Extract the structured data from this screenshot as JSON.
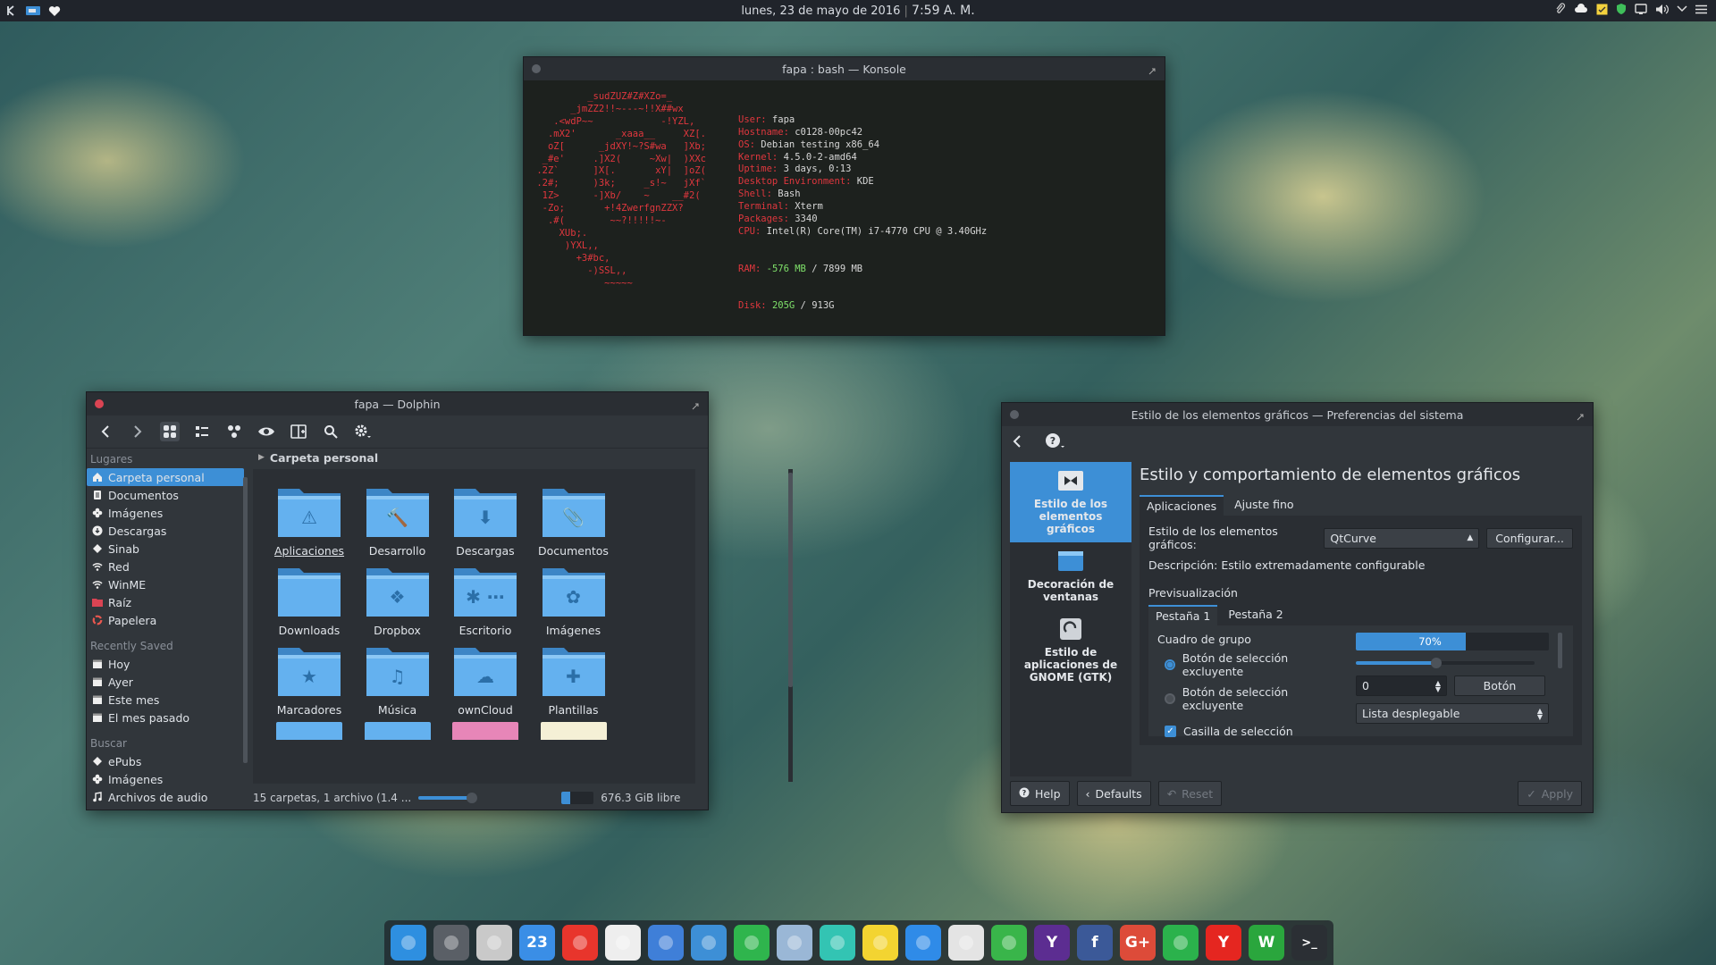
{
  "top_panel": {
    "clock_date": "lunes, 23 de mayo de 2016",
    "clock_time": "7:59 A. M.",
    "left_icons": [
      "kde-launcher-icon",
      "pager-icon",
      "heart-icon"
    ],
    "tray_icons": [
      "paperclip-icon",
      "cloud-icon",
      "note-icon",
      "shield-icon",
      "display-icon",
      "volume-icon",
      "chevron-down-icon",
      "menu-icon"
    ]
  },
  "konsole": {
    "title": "fapa : bash — Konsole",
    "logo_lines": [
      "          _sudZUZ#Z#XZo=_",
      "       _jmZZ2!!~---~!!X##wx",
      "    .<wdP~~            -!YZL,",
      "   .mX2'       _xaaa__     XZ[.",
      "   oZ[      _jdXY!~?S#wa   ]Xb;",
      "  _#e'     .]X2(     ~Xw|  )XXc",
      " .2Z`      ]X[.       xY|  ]oZ(",
      " .2#;      )3k;     _s!~   jXf`",
      "  1Z>      -]Xb/    ~    __#2(",
      "  -Zo;       +!4ZwerfgnZZX?",
      "   .#(        ~~?!!!!!~-",
      "     XUb;.",
      "      )YXL,,",
      "        +3#bc,",
      "          -)SSL,,",
      "             ~~~~~"
    ],
    "info": [
      {
        "key": "User:",
        "value": " fapa"
      },
      {
        "key": "Hostname:",
        "value": " c0128-00pc42"
      },
      {
        "key": "OS:",
        "value": " Debian testing x86_64"
      },
      {
        "key": "Kernel:",
        "value": " 4.5.0-2-amd64"
      },
      {
        "key": "Uptime:",
        "value": " 3 days, 0:13"
      },
      {
        "key": "Desktop Environment:",
        "value": " KDE"
      },
      {
        "key": "Shell:",
        "value": " Bash"
      },
      {
        "key": "Terminal:",
        "value": " Xterm"
      },
      {
        "key": "Packages:",
        "value": " 3340"
      },
      {
        "key": "CPU:",
        "value": " Intel(R) Core(TM) i7-4770 CPU @ 3.40GHz"
      }
    ],
    "ram_key": "RAM:",
    "ram_used": "-576 MB",
    "ram_total": " / 7899 MB",
    "disk_key": "Disk:",
    "disk_used": "205G",
    "disk_total": " / 913G"
  },
  "dolphin": {
    "title": "fapa — Dolphin",
    "places_header": "Lugares",
    "places": [
      {
        "label": "Carpeta personal",
        "icon": "home-icon",
        "selected": true
      },
      {
        "label": "Documentos",
        "icon": "document-icon"
      },
      {
        "label": "Imágenes",
        "icon": "flower-icon"
      },
      {
        "label": "Descargas",
        "icon": "download-icon"
      },
      {
        "label": "Sinab",
        "icon": "diamond-icon"
      },
      {
        "label": "Red",
        "icon": "wifi-icon"
      },
      {
        "label": "WinME",
        "icon": "wifi-icon"
      },
      {
        "label": "Raíz",
        "icon": "folder-red-icon"
      },
      {
        "label": "Papelera",
        "icon": "recycle-icon"
      }
    ],
    "recent_header": "Recently Saved",
    "recent": [
      {
        "label": "Hoy",
        "icon": "calendar-icon"
      },
      {
        "label": "Ayer",
        "icon": "calendar-icon"
      },
      {
        "label": "Este mes",
        "icon": "calendar-icon"
      },
      {
        "label": "El mes pasado",
        "icon": "calendar-icon"
      }
    ],
    "search_header": "Buscar",
    "search": [
      {
        "label": "ePubs",
        "icon": "diamond-icon"
      },
      {
        "label": "Imágenes",
        "icon": "flower-icon"
      },
      {
        "label": "Archivos de audio",
        "icon": "music-note-icon"
      }
    ],
    "breadcrumb": "Carpeta personal",
    "items": [
      {
        "label": "Aplicaciones",
        "glyph": "⚠"
      },
      {
        "label": "Desarrollo",
        "glyph": "🔨"
      },
      {
        "label": "Descargas",
        "glyph": "⬇"
      },
      {
        "label": "Documentos",
        "glyph": "📎"
      },
      {
        "label": "Downloads",
        "glyph": ""
      },
      {
        "label": "Dropbox",
        "glyph": "❖"
      },
      {
        "label": "Escritorio",
        "glyph": "✱ ⋯"
      },
      {
        "label": "Imágenes",
        "glyph": "✿"
      },
      {
        "label": "Marcadores",
        "glyph": "★"
      },
      {
        "label": "Música",
        "glyph": "♫"
      },
      {
        "label": "ownCloud",
        "glyph": "☁"
      },
      {
        "label": "Plantillas",
        "glyph": "✚"
      }
    ],
    "status_text": "15 carpetas, 1 archivo (1.4 ...",
    "free_space": "676.3 GiB libre",
    "free_fraction": 0.26
  },
  "settings": {
    "title": "Estilo de los elementos gráficos  — Preferencias del sistema",
    "categories": [
      {
        "label": "Estilo de los elementos gráficos",
        "selected": true
      },
      {
        "label": "Decoración de ventanas"
      },
      {
        "label": "Estilo de aplicaciones de GNOME (GTK)"
      }
    ],
    "heading": "Estilo y comportamiento de elementos gráficos",
    "tabs": [
      "Aplicaciones",
      "Ajuste fino"
    ],
    "style_label": "Estilo de los elementos gráficos:",
    "style_value": "QtCurve",
    "configure_label": "Configurar...",
    "description": "Descripción: Estilo extremadamente configurable",
    "preview_label": "Previsualización",
    "preview_tabs": [
      "Pestaña 1",
      "Pestaña 2"
    ],
    "group_box": "Cuadro de grupo",
    "radio1": "Botón de selección excluyente",
    "radio2": "Botón de selección excluyente",
    "checkbox": "Casilla de selección",
    "progress_text": "70%",
    "progress_value": 0.7,
    "slider_value": 0.45,
    "spin_value": "0",
    "button_label": "Botón",
    "dropdown_label": "Lista desplegable",
    "help": "Help",
    "defaults": "Defaults",
    "reset": "Reset",
    "apply": "Apply"
  },
  "dock": {
    "calendar_day": "23",
    "items": [
      {
        "name": "finder-icon",
        "color": "#2e8fe0"
      },
      {
        "name": "system-settings-icon",
        "color": "#5a5f66"
      },
      {
        "name": "software-install-icon",
        "color": "#c9c9c9"
      },
      {
        "name": "calendar-icon",
        "color": "#3a8ee6"
      },
      {
        "name": "pdf-reader-icon",
        "color": "#e8352c"
      },
      {
        "name": "text-document-icon",
        "color": "#eeeeee"
      },
      {
        "name": "notes-icon",
        "color": "#3f7fd8"
      },
      {
        "name": "app-store-icon",
        "color": "#3d8fd6"
      },
      {
        "name": "security-shield-icon",
        "color": "#2fb54d"
      },
      {
        "name": "network-icon",
        "color": "#9ab7d6"
      },
      {
        "name": "music-icon",
        "color": "#33c4b3"
      },
      {
        "name": "todo-icon",
        "color": "#f3d431"
      },
      {
        "name": "safari-icon",
        "color": "#2f8be8"
      },
      {
        "name": "chrome-icon",
        "color": "#e4e4e4"
      },
      {
        "name": "twitter-icon",
        "color": "#39b54a"
      },
      {
        "name": "yahoo-icon",
        "color": "#5c2d91"
      },
      {
        "name": "facebook-icon",
        "color": "#3b5998"
      },
      {
        "name": "google-plus-icon",
        "color": "#dd4b39"
      },
      {
        "name": "feedly-icon",
        "color": "#2bb24c"
      },
      {
        "name": "yandex-icon",
        "color": "#e52620"
      },
      {
        "name": "wps-writer-icon",
        "color": "#2aa63d"
      },
      {
        "name": "terminal-icon",
        "color": "#2b2f34"
      }
    ],
    "letters": {
      "yahoo": "Y",
      "facebook": "f",
      "google": "G+",
      "yandex": "Y",
      "writer": "W",
      "terminal": ">_"
    }
  }
}
